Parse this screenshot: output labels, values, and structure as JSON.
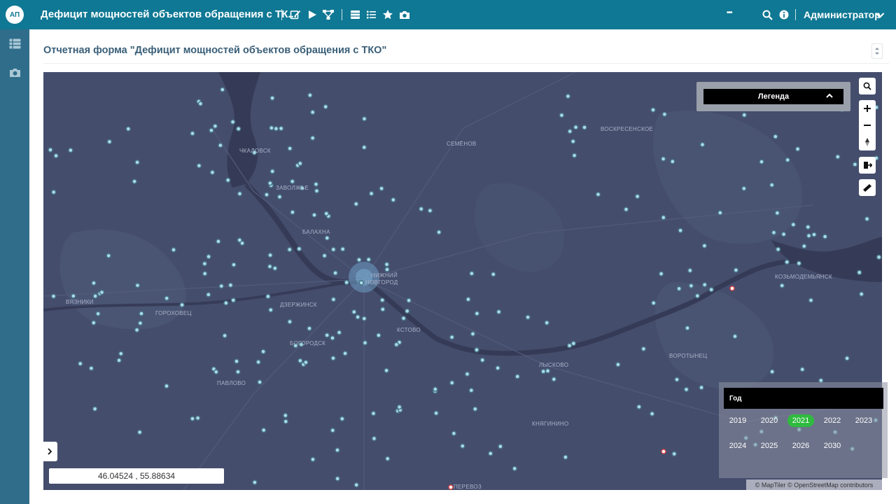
{
  "header": {
    "avatar_initials": "АП",
    "title": "Дефицит мощностей объектов обращения с ТК...",
    "more": "•••",
    "user_name": "Администратор",
    "accent": "#0f7894",
    "icons": [
      "edit-icon",
      "play-icon",
      "network-icon",
      "table-icon",
      "list-icon",
      "star-icon",
      "camera-icon",
      "search-icon",
      "info-icon",
      "chevron-down-icon"
    ]
  },
  "sidebar": {
    "bg": "#2f6d8a",
    "items": [
      {
        "icon": "table-icon"
      },
      {
        "icon": "camera-icon"
      }
    ]
  },
  "report": {
    "title": "Отчетная форма \"Дефицит мощностей объектов обращения с ТКО\""
  },
  "map": {
    "labels": [
      "ЧКАЛОВСК",
      "ЗАВОЛЖЬЕ",
      "БАЛАХНА",
      "НИЖНИЙ",
      "НОВГОРОД",
      "СЕМЁНОВ",
      "ВОСКРЕСЕНСКОЕ",
      "КОЗЬМОДЕМЬЯНСК",
      "ВЯЗНИКИ",
      "ГОРОХОВЕЦ",
      "ДЗЕРЖИНСК",
      "КСТОВО",
      "БОГОРОДСК",
      "ЛЫСКОВО",
      "ВОРОТЫНЕЦ",
      "ПАВЛОВО",
      "КНЯГИНИНО",
      "ПЕРЕВОЗ"
    ],
    "legend": {
      "title": "Легенда"
    },
    "controls": [
      "search-icon",
      "zoom-in-icon",
      "zoom-out-icon",
      "compass-icon",
      "export-icon",
      "ruler-icon"
    ],
    "year_filter": {
      "title": "Год",
      "years": [
        "2019",
        "2020",
        "2021",
        "2022",
        "2023",
        "2024",
        "2025",
        "2026",
        "2030"
      ],
      "selected": "2021"
    },
    "coordinates": "46.04524 , 55.88634",
    "attribution": "© MapTiler © OpenStreetMap contributors",
    "colors": {
      "background": "#454d6d",
      "point": "#a8dce8",
      "point_alert": "#d54545",
      "year_selected": "#2fbb3f"
    }
  }
}
